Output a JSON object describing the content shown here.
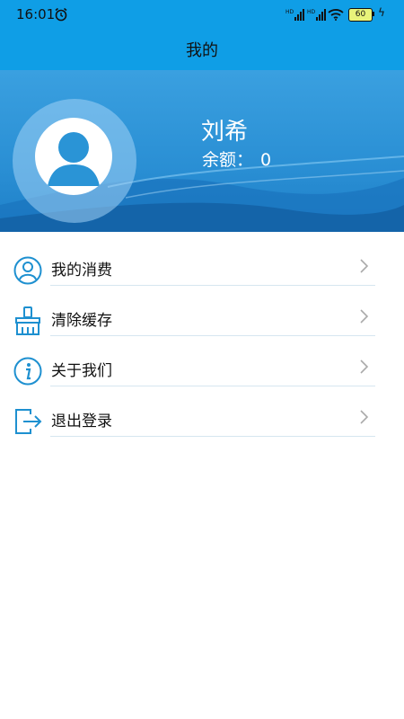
{
  "status_bar": {
    "time": "16:01",
    "battery": "60"
  },
  "header": {
    "title": "我的"
  },
  "profile": {
    "name": "刘希",
    "balance_label": "余额：",
    "balance_value": "0"
  },
  "menu": [
    {
      "label": "我的消费",
      "icon": "user-circle-icon"
    },
    {
      "label": "清除缓存",
      "icon": "broom-icon"
    },
    {
      "label": "关于我们",
      "icon": "info-icon"
    },
    {
      "label": "退出登录",
      "icon": "logout-icon"
    }
  ],
  "colors": {
    "primary": "#0f9ee6",
    "icon": "#1e90d0",
    "divider": "#d6e6f0"
  }
}
